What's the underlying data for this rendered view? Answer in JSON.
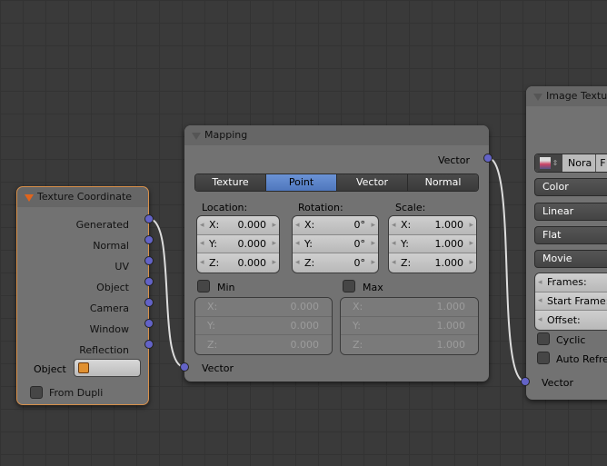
{
  "tex_coord": {
    "title": "Texture Coordinate",
    "outputs": [
      "Generated",
      "Normal",
      "UV",
      "Object",
      "Camera",
      "Window",
      "Reflection"
    ],
    "object_label": "Object",
    "from_dupli": "From Dupli"
  },
  "mapping": {
    "title": "Mapping",
    "output": "Vector",
    "input": "Vector",
    "tabs": [
      "Texture",
      "Point",
      "Vector",
      "Normal"
    ],
    "active_tab": "Point",
    "location": {
      "label": "Location:",
      "x": "0.000",
      "y": "0.000",
      "z": "0.000"
    },
    "rotation": {
      "label": "Rotation:",
      "x": "0°",
      "y": "0°",
      "z": "0°"
    },
    "scale": {
      "label": "Scale:",
      "x": "1.000",
      "y": "1.000",
      "z": "1.000"
    },
    "min": {
      "label": "Min",
      "x": "0.000",
      "y": "0.000",
      "z": "0.000"
    },
    "max": {
      "label": "Max",
      "x": "1.000",
      "y": "1.000",
      "z": "1.000"
    },
    "axis": {
      "x": "X:",
      "y": "Y:",
      "z": "Z:"
    }
  },
  "image": {
    "title": "Image Textur",
    "image_name": "Nora",
    "btn_f": "F",
    "color": "Color",
    "interp": "Linear",
    "proj": "Flat",
    "source": "Movie",
    "frames": "Frames:",
    "start_frame": "Start Frame:",
    "offset": "Offset:",
    "cyclic": "Cyclic",
    "auto_refresh": "Auto Refres",
    "input": "Vector"
  }
}
